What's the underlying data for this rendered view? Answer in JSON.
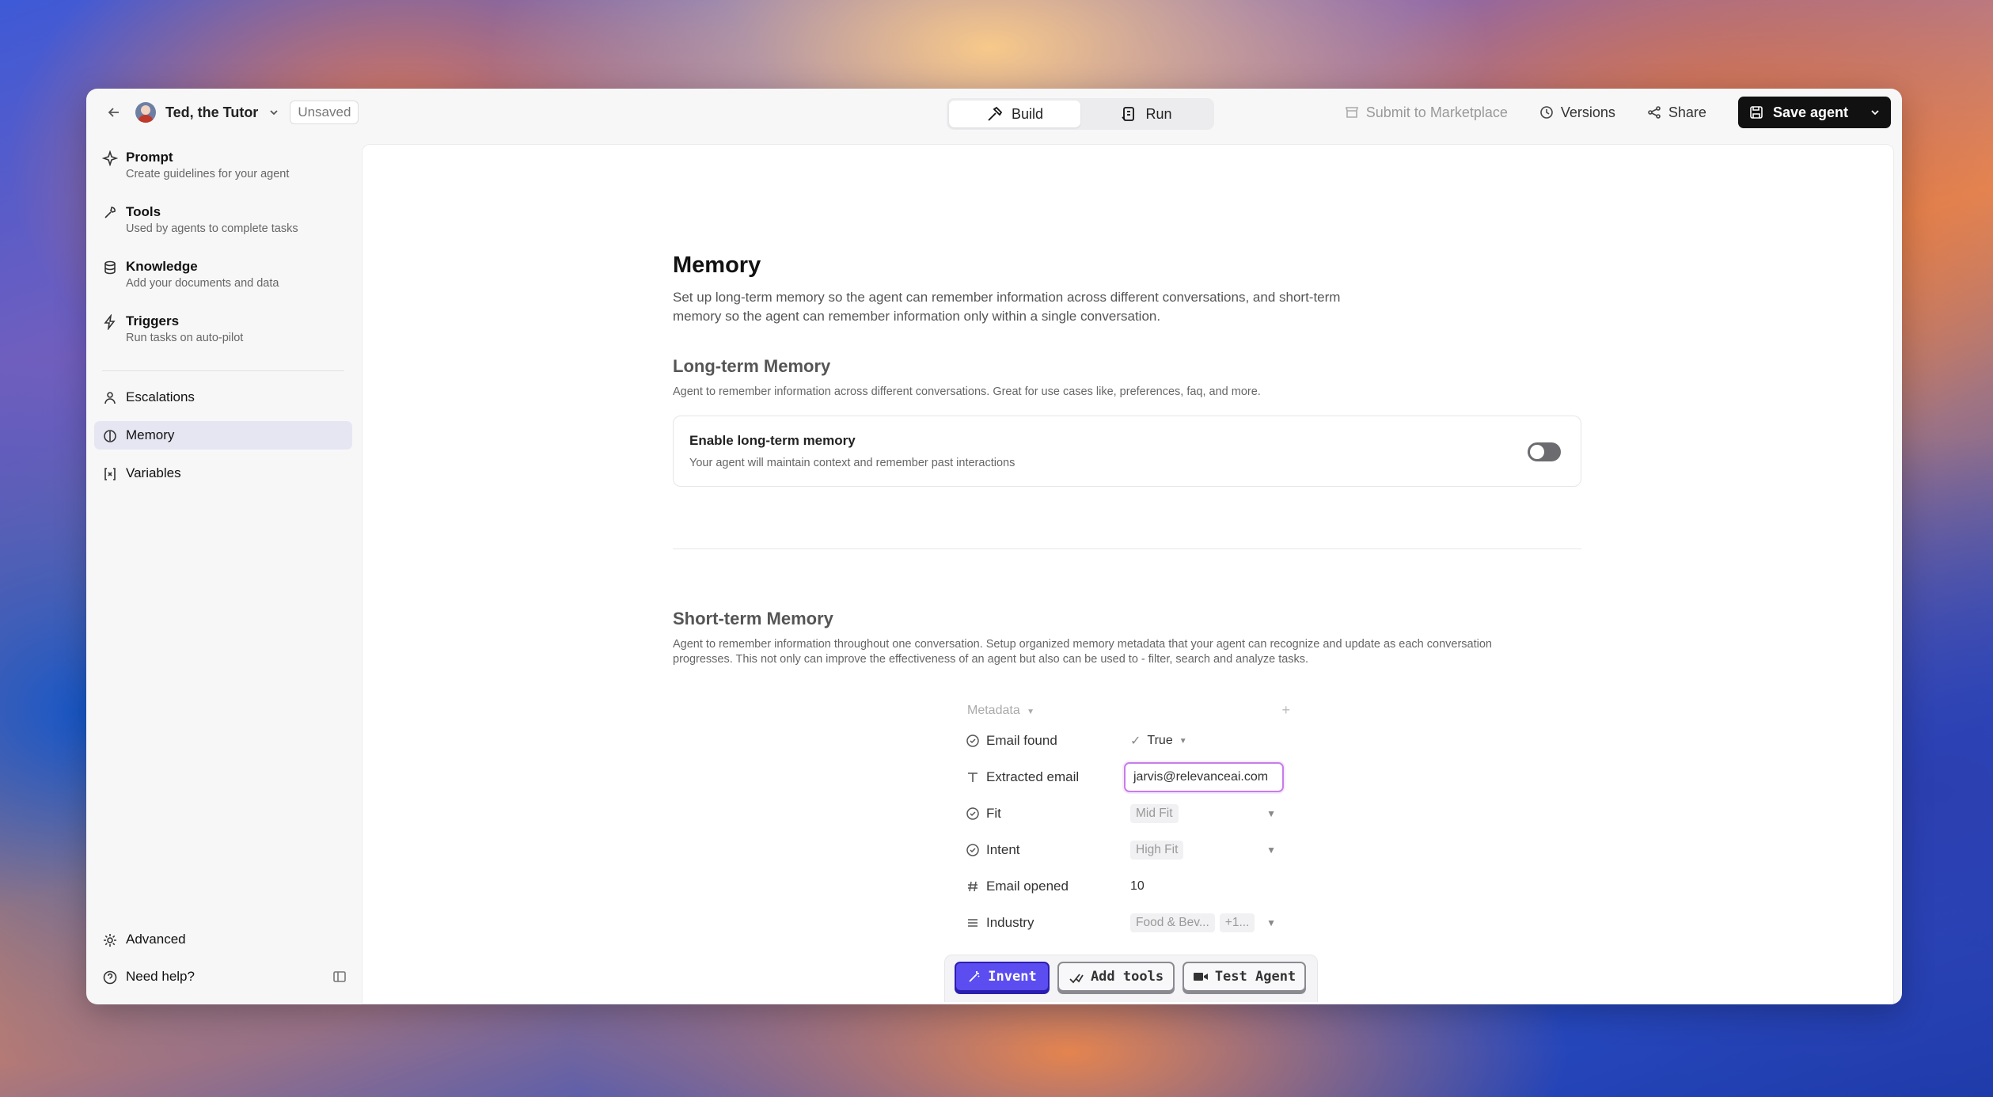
{
  "header": {
    "agent_name": "Ted, the Tutor",
    "status": "Unsaved",
    "tabs": [
      {
        "label": "Build",
        "active": true
      },
      {
        "label": "Run",
        "active": false
      }
    ],
    "submit_label": "Submit to Marketplace",
    "versions_label": "Versions",
    "share_label": "Share",
    "save_label": "Save agent"
  },
  "sidebar": {
    "items": [
      {
        "title": "Prompt",
        "subtitle": "Create guidelines for your agent",
        "icon": "sparkle-icon"
      },
      {
        "title": "Tools",
        "subtitle": "Used by agents to complete tasks",
        "icon": "wrench-icon"
      },
      {
        "title": "Knowledge",
        "subtitle": "Add your documents and data",
        "icon": "database-icon"
      },
      {
        "title": "Triggers",
        "subtitle": "Run tasks on auto-pilot",
        "icon": "bolt-icon"
      }
    ],
    "secondary": [
      {
        "title": "Escalations",
        "icon": "person-icon",
        "active": false
      },
      {
        "title": "Memory",
        "icon": "memory-icon",
        "active": true
      },
      {
        "title": "Variables",
        "icon": "variable-icon",
        "active": false
      }
    ],
    "advanced_label": "Advanced",
    "help_label": "Need help?"
  },
  "main": {
    "title": "Memory",
    "description": "Set up long-term memory so the agent can remember information across different conversations, and short-term memory so the agent can remember information only within a single conversation.",
    "long_term": {
      "title": "Long-term Memory",
      "description": "Agent to remember information across different conversations. Great for use cases like, preferences, faq, and more.",
      "toggle_title": "Enable long-term memory",
      "toggle_subtitle": "Your agent will maintain context and remember past interactions",
      "enabled": false
    },
    "short_term": {
      "title": "Short-term Memory",
      "description": "Agent to remember information throughout one conversation. Setup organized memory metadata that your agent can recognize and update as each conversation progresses. This not only can improve the effectiveness of an agent but also can be used to - filter, search and analyze tasks."
    },
    "metadata": {
      "header": "Metadata",
      "rows": [
        {
          "label": "Email found",
          "value": "True",
          "icon": "check-circle-icon"
        },
        {
          "label": "Extracted email",
          "value": "jarvis@relevanceai.com",
          "icon": "text-icon"
        },
        {
          "label": "Fit",
          "value": "Mid Fit",
          "icon": "check-circle-icon"
        },
        {
          "label": "Intent",
          "value": "High Fit",
          "icon": "check-circle-icon"
        },
        {
          "label": "Email opened",
          "value": "10",
          "icon": "hash-icon"
        },
        {
          "label": "Industry",
          "value": "Food & Bev...",
          "extra": "+1...",
          "icon": "list-icon"
        }
      ]
    }
  },
  "bottom_bar": {
    "invent_label": "Invent",
    "add_tools_label": "Add tools",
    "test_agent_label": "Test Agent"
  }
}
